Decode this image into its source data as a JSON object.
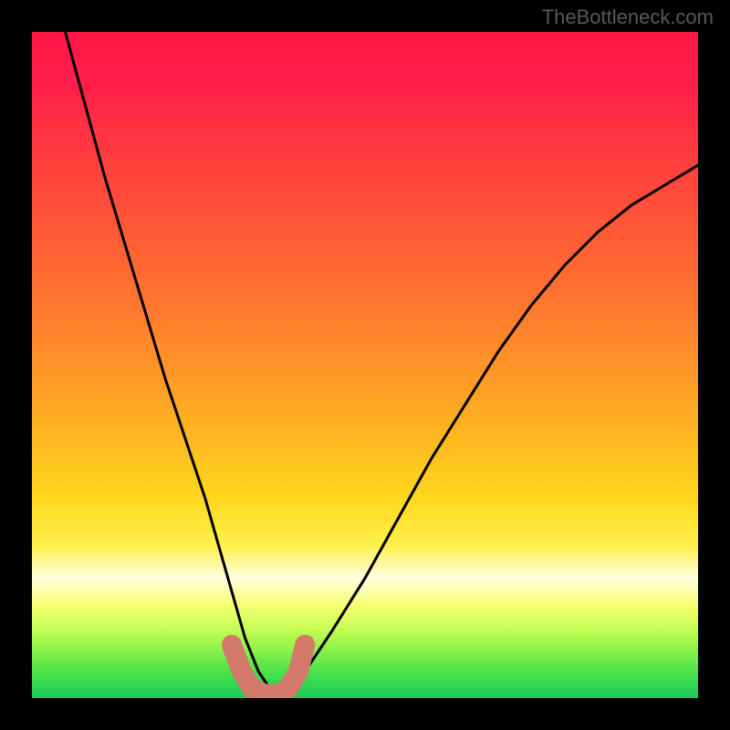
{
  "watermark": "TheBottleneck.com",
  "chart_data": {
    "type": "line",
    "title": "",
    "xlabel": "",
    "ylabel": "",
    "xlim": [
      0,
      100
    ],
    "ylim": [
      0,
      100
    ],
    "series": [
      {
        "name": "bottleneck-curve",
        "x": [
          5,
          8,
          11,
          14,
          17,
          20,
          23,
          26,
          28,
          30,
          32,
          34,
          36,
          38,
          41,
          45,
          50,
          55,
          60,
          65,
          70,
          75,
          80,
          85,
          90,
          95,
          100
        ],
        "values": [
          100,
          89,
          78,
          68,
          58,
          48,
          39,
          30,
          23,
          16,
          9,
          4,
          1,
          1,
          4,
          10,
          18,
          27,
          36,
          44,
          52,
          59,
          65,
          70,
          74,
          77,
          80
        ]
      },
      {
        "name": "highlight-band",
        "x": [
          30,
          31.5,
          33,
          35,
          37,
          38.5,
          40,
          41
        ],
        "values": [
          8,
          4,
          1.5,
          0.6,
          0.6,
          1.5,
          4,
          8
        ]
      }
    ],
    "gradient_stops": [
      {
        "pos": 0,
        "color": "#ff1744"
      },
      {
        "pos": 50,
        "color": "#ff9a26"
      },
      {
        "pos": 78,
        "color": "#fff04a"
      },
      {
        "pos": 100,
        "color": "#1fc75a"
      }
    ]
  }
}
